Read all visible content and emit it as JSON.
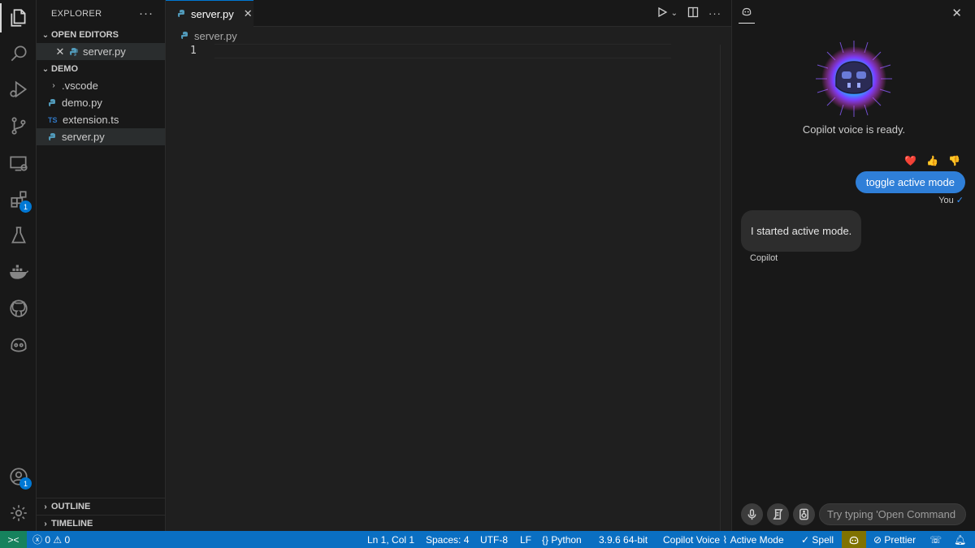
{
  "sidebar": {
    "title": "EXPLORER",
    "more_label": "···",
    "open_editors_label": "OPEN EDITORS",
    "open_editors": [
      {
        "name": "server.py"
      }
    ],
    "folder_label": "DEMO",
    "files": [
      {
        "name": ".vscode",
        "type": "folder"
      },
      {
        "name": "demo.py",
        "type": "python"
      },
      {
        "name": "extension.ts",
        "type": "typescript",
        "icon_text": "TS"
      },
      {
        "name": "server.py",
        "type": "python",
        "selected": true
      }
    ],
    "outline_label": "OUTLINE",
    "timeline_label": "TIMELINE"
  },
  "activity": {
    "extensions_badge": "1",
    "accounts_badge": "1"
  },
  "editor": {
    "tab_label": "server.py",
    "tab_close": "✕",
    "breadcrumb": "server.py",
    "line_number": "1"
  },
  "chat": {
    "ready_text": "Copilot voice is ready.",
    "reactions": [
      "❤️",
      "👍",
      "👎"
    ],
    "user_message": "toggle active mode",
    "user_label": "You",
    "user_check": "✓",
    "bot_message": "I started active mode.",
    "bot_label": "Copilot",
    "input_placeholder": "Try typing 'Open Command P"
  },
  "status": {
    "remote_icon": "><",
    "errors": "0",
    "warnings": "0",
    "position": "Ln 1, Col 1",
    "spaces": "Spaces: 4",
    "encoding": "UTF-8",
    "eol": "LF",
    "language": "Python",
    "interpreter": "3.9.6 64-bit",
    "copilot_voice": "Copilot Voice",
    "active_mode": "Active Mode",
    "spell": "Spell",
    "prettier": "Prettier"
  },
  "colors": {
    "accent": "#0078d4",
    "status_bar": "#0a6fc2",
    "user_bubble": "#2f7fd8",
    "remote": "#16825d"
  }
}
